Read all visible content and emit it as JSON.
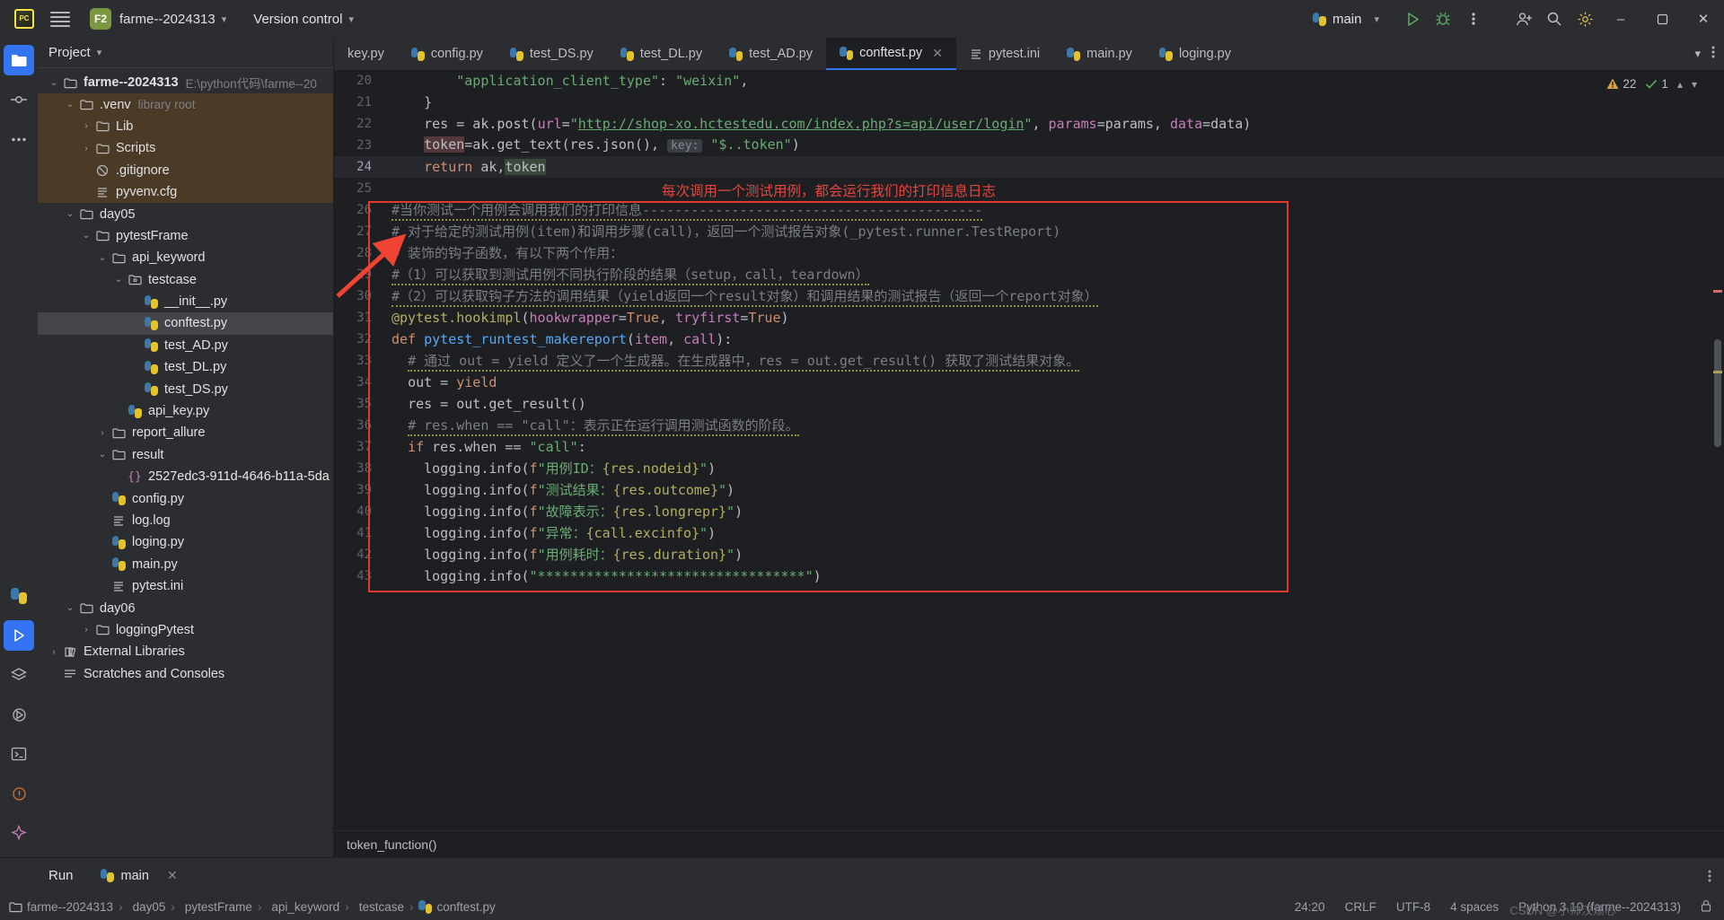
{
  "titlebar": {
    "logo_alt": "PC",
    "project_badge": "F2",
    "project_name": "farme--2024313",
    "version_control": "Version control",
    "run_config": "main",
    "icons": [
      "run-icon",
      "debug-icon",
      "more-vertical-icon",
      "add-user-icon",
      "search-icon",
      "settings-icon"
    ],
    "window_min": "–",
    "window_max": "❐",
    "window_close": "✕"
  },
  "rail": {
    "items": [
      {
        "name": "project-tool-icon",
        "glyph": "folder"
      },
      {
        "name": "commit-tool-icon",
        "glyph": "commit"
      },
      {
        "name": "more-tool-icon",
        "glyph": "dots"
      },
      {
        "name": "python-packages-icon",
        "glyph": "python"
      },
      {
        "name": "run-tool-icon",
        "glyph": "run"
      },
      {
        "name": "services-icon",
        "glyph": "layers"
      },
      {
        "name": "debug-tool-icon",
        "glyph": "debug"
      },
      {
        "name": "terminal-icon",
        "glyph": "terminal"
      },
      {
        "name": "problems-icon",
        "glyph": "problems"
      },
      {
        "name": "ai-assistant-icon",
        "glyph": "ai"
      }
    ]
  },
  "project_panel": {
    "header": "Project",
    "tree": [
      {
        "depth": 0,
        "arrow": "down",
        "icon": "folder",
        "label": "farme--2024313",
        "sub": "E:\\python代码\\farme--20",
        "bold": true,
        "selected": false,
        "venv": false
      },
      {
        "depth": 1,
        "arrow": "down",
        "icon": "folder",
        "label": ".venv",
        "sub": "library root",
        "bold": false,
        "selected": false,
        "venv": true
      },
      {
        "depth": 2,
        "arrow": "right",
        "icon": "folder",
        "label": "Lib",
        "sub": "",
        "bold": false,
        "selected": false,
        "venv": true
      },
      {
        "depth": 2,
        "arrow": "right",
        "icon": "folder",
        "label": "Scripts",
        "sub": "",
        "bold": false,
        "selected": false,
        "venv": true
      },
      {
        "depth": 2,
        "arrow": "none",
        "icon": "gitignore",
        "label": ".gitignore",
        "sub": "",
        "bold": false,
        "selected": false,
        "venv": true
      },
      {
        "depth": 2,
        "arrow": "none",
        "icon": "text",
        "label": "pyvenv.cfg",
        "sub": "",
        "bold": false,
        "selected": false,
        "venv": true
      },
      {
        "depth": 1,
        "arrow": "down",
        "icon": "folder",
        "label": "day05",
        "sub": "",
        "bold": false,
        "selected": false,
        "venv": false
      },
      {
        "depth": 2,
        "arrow": "down",
        "icon": "folder",
        "label": "pytestFrame",
        "sub": "",
        "bold": false,
        "selected": false,
        "venv": false
      },
      {
        "depth": 3,
        "arrow": "down",
        "icon": "folder",
        "label": "api_keyword",
        "sub": "",
        "bold": false,
        "selected": false,
        "venv": false
      },
      {
        "depth": 4,
        "arrow": "down",
        "icon": "folder-dot",
        "label": "testcase",
        "sub": "",
        "bold": false,
        "selected": false,
        "venv": false
      },
      {
        "depth": 5,
        "arrow": "none",
        "icon": "python",
        "label": "__init__.py",
        "sub": "",
        "bold": false,
        "selected": false,
        "venv": false
      },
      {
        "depth": 5,
        "arrow": "none",
        "icon": "python",
        "label": "conftest.py",
        "sub": "",
        "bold": false,
        "selected": true,
        "venv": false
      },
      {
        "depth": 5,
        "arrow": "none",
        "icon": "python",
        "label": "test_AD.py",
        "sub": "",
        "bold": false,
        "selected": false,
        "venv": false
      },
      {
        "depth": 5,
        "arrow": "none",
        "icon": "python",
        "label": "test_DL.py",
        "sub": "",
        "bold": false,
        "selected": false,
        "venv": false
      },
      {
        "depth": 5,
        "arrow": "none",
        "icon": "python",
        "label": "test_DS.py",
        "sub": "",
        "bold": false,
        "selected": false,
        "venv": false
      },
      {
        "depth": 4,
        "arrow": "none",
        "icon": "python",
        "label": "api_key.py",
        "sub": "",
        "bold": false,
        "selected": false,
        "venv": false
      },
      {
        "depth": 3,
        "arrow": "right",
        "icon": "folder",
        "label": "report_allure",
        "sub": "",
        "bold": false,
        "selected": false,
        "venv": false
      },
      {
        "depth": 3,
        "arrow": "down",
        "icon": "folder",
        "label": "result",
        "sub": "",
        "bold": false,
        "selected": false,
        "venv": false
      },
      {
        "depth": 4,
        "arrow": "none",
        "icon": "json",
        "label": "2527edc3-911d-4646-b11a-5da",
        "sub": "",
        "bold": false,
        "selected": false,
        "venv": false
      },
      {
        "depth": 3,
        "arrow": "none",
        "icon": "python",
        "label": "config.py",
        "sub": "",
        "bold": false,
        "selected": false,
        "venv": false
      },
      {
        "depth": 3,
        "arrow": "none",
        "icon": "text",
        "label": "log.log",
        "sub": "",
        "bold": false,
        "selected": false,
        "venv": false
      },
      {
        "depth": 3,
        "arrow": "none",
        "icon": "python",
        "label": "loging.py",
        "sub": "",
        "bold": false,
        "selected": false,
        "venv": false
      },
      {
        "depth": 3,
        "arrow": "none",
        "icon": "python",
        "label": "main.py",
        "sub": "",
        "bold": false,
        "selected": false,
        "venv": false
      },
      {
        "depth": 3,
        "arrow": "none",
        "icon": "text",
        "label": "pytest.ini",
        "sub": "",
        "bold": false,
        "selected": false,
        "venv": false
      },
      {
        "depth": 1,
        "arrow": "down",
        "icon": "folder",
        "label": "day06",
        "sub": "",
        "bold": false,
        "selected": false,
        "venv": false
      },
      {
        "depth": 2,
        "arrow": "right",
        "icon": "folder",
        "label": "loggingPytest",
        "sub": "",
        "bold": false,
        "selected": false,
        "venv": false
      },
      {
        "depth": 0,
        "arrow": "right",
        "icon": "library",
        "label": "External Libraries",
        "sub": "",
        "bold": false,
        "selected": false,
        "venv": false
      },
      {
        "depth": 0,
        "arrow": "none",
        "icon": "scratch",
        "label": "Scratches and Consoles",
        "sub": "",
        "bold": false,
        "selected": false,
        "venv": false
      }
    ]
  },
  "editor": {
    "tabs": [
      {
        "label": "key.py",
        "icon": "none",
        "active": false,
        "closable": false
      },
      {
        "label": "config.py",
        "icon": "python",
        "active": false,
        "closable": false
      },
      {
        "label": "test_DS.py",
        "icon": "python",
        "active": false,
        "closable": false
      },
      {
        "label": "test_DL.py",
        "icon": "python",
        "active": false,
        "closable": false
      },
      {
        "label": "test_AD.py",
        "icon": "python",
        "active": false,
        "closable": false
      },
      {
        "label": "conftest.py",
        "icon": "python",
        "active": true,
        "closable": true
      },
      {
        "label": "pytest.ini",
        "icon": "text",
        "active": false,
        "closable": false
      },
      {
        "label": "main.py",
        "icon": "python",
        "active": false,
        "closable": false
      },
      {
        "label": "loging.py",
        "icon": "python",
        "active": false,
        "closable": false
      }
    ],
    "tab_overflow_icon": "chevron-down-icon",
    "tab_more_icon": "more-vertical-icon",
    "inspection": {
      "warnings": "22",
      "oks": "1"
    },
    "breadcrumb": "token_function()",
    "lines": [
      {
        "n": "20",
        "html": "        <span class=\"s\">\"application_client_type\"</span><span class=\"nm\">: </span><span class=\"s\">\"weixin\"</span><span class=\"nm\">,</span>"
      },
      {
        "n": "21",
        "html": "    <span class=\"nm\">}</span>"
      },
      {
        "n": "22",
        "html": "    <span class=\"nm\">res = ak.post(</span><span class=\"pm\">url</span><span class=\"nm\">=</span><span class=\"s\">\"</span><span class=\"url\">http://shop-xo.hctestedu.com/index.php?s=api/user/login</span><span class=\"s\">\"</span><span class=\"nm\">, </span><span class=\"pm\">params</span><span class=\"nm\">=params, </span><span class=\"pm\">data</span><span class=\"nm\">=data)</span>"
      },
      {
        "n": "23",
        "html": "    <span class=\"err-hl\">token</span><span class=\"nm\">=ak.get_text(res.json(), </span><span class=\"hintbg\">key:</span><span class=\"nm\"> </span><span class=\"s\">\"$..token\"</span><span class=\"nm\">)</span>"
      },
      {
        "n": "24",
        "html": "    <span class=\"kw\">return</span><span class=\"nm\"> ak,</span><span class=\"sel-hl\">token</span>",
        "current": true
      },
      {
        "n": "25",
        "html": ""
      },
      {
        "n": "26",
        "html": "<span class=\"cm wavy\">#当你测试一个用例会调用我们的打印信息------------------------------------------</span>"
      },
      {
        "n": "27",
        "html": "<span class=\"cm\"># 对于给定的测试用例(item)和调用步骤(call)，返回一个测试报告对象(_pytest.runner.TestReport)</span>"
      },
      {
        "n": "28",
        "html": "<span class=\"cm\"># 装饰的钩子函数，有以下两个作用：</span>"
      },
      {
        "n": "29",
        "html": "<span class=\"cm wavy\">#（1）可以获取到测试用例不同执行阶段的结果（setup，call，teardown）</span>"
      },
      {
        "n": "30",
        "html": "<span class=\"cm wavy\">#（2）可以获取钩子方法的调用结果（yield返回一个result对象）和调用结果的测试报告（返回一个report对象）</span>"
      },
      {
        "n": "31",
        "html": "<span class=\"dec\">@pytest.hookimpl</span><span class=\"nm\">(</span><span class=\"pm\">hookwrapper</span><span class=\"nm\">=</span><span class=\"kw\">True</span><span class=\"nm\">, </span><span class=\"pm\">tryfirst</span><span class=\"nm\">=</span><span class=\"kw\">True</span><span class=\"nm\">)</span>"
      },
      {
        "n": "32",
        "html": "<span class=\"kw\">def</span><span class=\"nm\"> </span><span class=\"fn\">pytest_runtest_makereport</span><span class=\"nm\">(</span><span class=\"pm\">item</span><span class=\"nm\">, </span><span class=\"pm\">call</span><span class=\"nm\">):</span>"
      },
      {
        "n": "33",
        "html": "  <span class=\"cm wavy\"># 通过 out = yield 定义了一个生成器。在生成器中，res = out.get_result() 获取了测试结果对象。</span>"
      },
      {
        "n": "34",
        "html": "  <span class=\"nm\">out = </span><span class=\"kw\">yield</span>"
      },
      {
        "n": "35",
        "html": "  <span class=\"nm\">res = out.get_result()</span>"
      },
      {
        "n": "36",
        "html": "  <span class=\"cm wavy\"># res.when == \"call\"：表示正在运行调用测试函数的阶段。</span>"
      },
      {
        "n": "37",
        "html": "  <span class=\"kw\">if</span><span class=\"nm\"> res.when == </span><span class=\"s\">\"call\"</span><span class=\"nm\">:</span>"
      },
      {
        "n": "38",
        "html": "    <span class=\"nm\">logging.info(</span><span class=\"kw\">f</span><span class=\"s\">\"用例ID：</span><span class=\"dec\">{res.nodeid}</span><span class=\"s\">\"</span><span class=\"nm\">)</span>"
      },
      {
        "n": "39",
        "html": "    <span class=\"nm\">logging.info(</span><span class=\"kw\">f</span><span class=\"s\">\"测试结果：</span><span class=\"dec\">{res.outcome}</span><span class=\"s\">\"</span><span class=\"nm\">)</span>"
      },
      {
        "n": "40",
        "html": "    <span class=\"nm\">logging.info(</span><span class=\"kw\">f</span><span class=\"s\">\"故障表示：</span><span class=\"dec\">{res.longrepr}</span><span class=\"s\">\"</span><span class=\"nm\">)</span>"
      },
      {
        "n": "41",
        "html": "    <span class=\"nm\">logging.info(</span><span class=\"kw\">f</span><span class=\"s\">\"异常：</span><span class=\"dec\">{call.excinfo}</span><span class=\"s\">\"</span><span class=\"nm\">)</span>"
      },
      {
        "n": "42",
        "html": "    <span class=\"nm\">logging.info(</span><span class=\"kw\">f</span><span class=\"s\">\"用例耗时：</span><span class=\"dec\">{res.duration}</span><span class=\"s\">\"</span><span class=\"nm\">)</span>"
      },
      {
        "n": "43",
        "html": "    <span class=\"nm\">logging.info(</span><span class=\"s\">\"*********************************\"</span><span class=\"nm\">)</span>"
      }
    ]
  },
  "annotation": {
    "label": "每次调用一个测试用例，都会运行我们的打印信息日志",
    "box_color": "#e03a2f",
    "arrow_color": "#ef4433"
  },
  "run_panel": {
    "title": "Run",
    "tab": "main",
    "close_icon": "close-icon"
  },
  "statusbar": {
    "breadcrumbs": [
      "farme--2024313",
      "day05",
      "pytestFrame",
      "api_keyword",
      "testcase",
      "conftest.py"
    ],
    "caret": "24:20",
    "line_sep": "CRLF",
    "encoding": "UTF-8",
    "indent": "4 spaces",
    "interpreter": "Python 3.10 (farme--2024313)",
    "watermark": "CSDN @小帅汉烦心"
  }
}
